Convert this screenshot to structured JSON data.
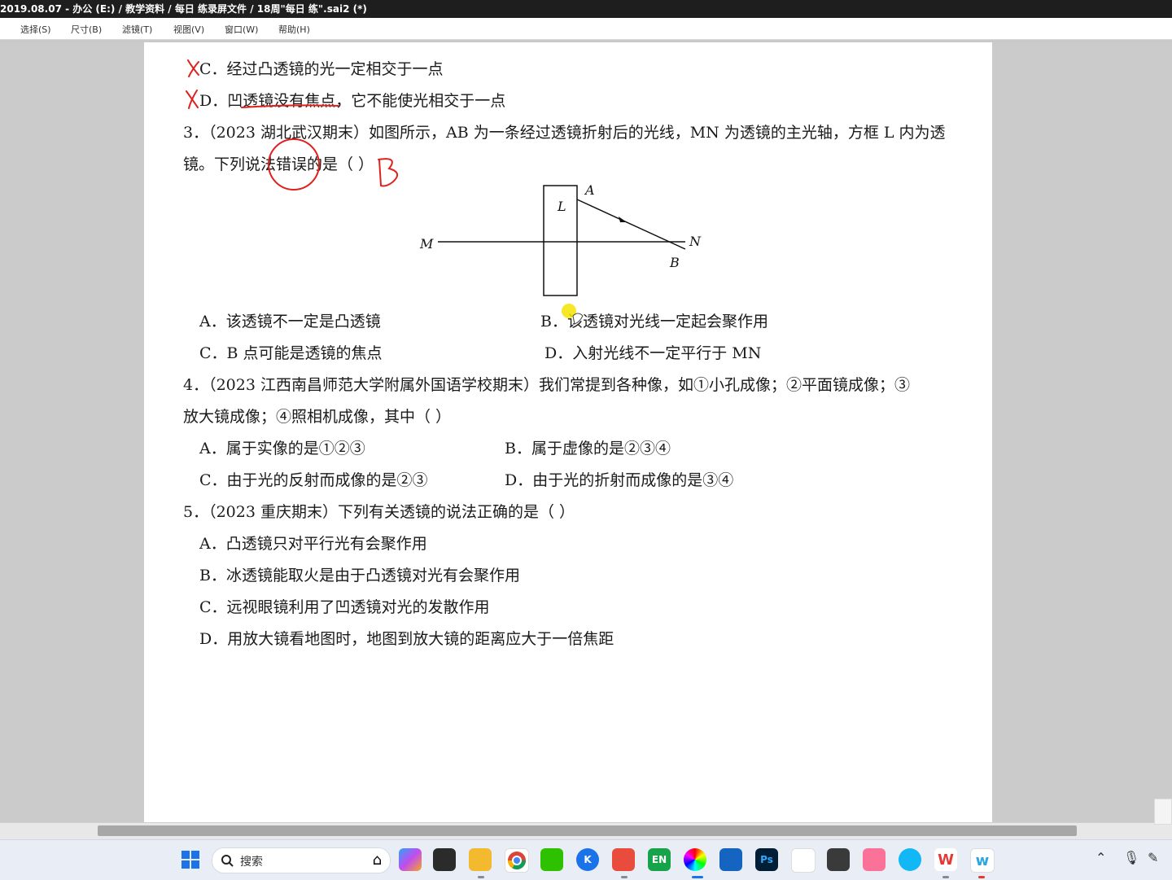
{
  "window": {
    "title": "2019.08.07 - 办公 (E:) / 教学资料 / 每日   练录屏文件 / 18周\"每日   练\".sai2 (*)"
  },
  "menu": [
    "选择(S)",
    "尺寸(B)",
    "滤镜(T)",
    "视图(V)",
    "窗口(W)",
    "帮助(H)"
  ],
  "document": {
    "line_c_prev": "C．经过凸透镜的光一定相交于一点",
    "line_d_prev": "D．凹透镜没有焦点，它不能使光相交于一点",
    "q3_line1": "3．（2023 湖北武汉期末）如图所示，AB 为一条经过透镜折射后的光线，MN 为透镜的主光轴，方框 L 内为透",
    "q3_line2": "镜。下列说法错误的是（      ）",
    "q3_options": {
      "a": "A．该透镜不一定是凸透镜",
      "b": "B．该透镜对光线一定起会聚作用",
      "c": "C．B 点可能是透镜的焦点",
      "d": "D．入射光线不一定平行于 MN"
    },
    "q4_line1": "4．（2023 江西南昌师范大学附属外国语学校期末）我们常提到各种像，如①小孔成像；②平面镜成像；③",
    "q4_line2": "放大镜成像；④照相机成像，其中（      ）",
    "q4_options": {
      "a": "A．属于实像的是①②③",
      "b": "B．属于虚像的是②③④",
      "c": "C．由于光的反射而成像的是②③",
      "d": "D．由于光的折射而成像的是③④"
    },
    "q5_line1": "5．（2023 重庆期末）下列有关透镜的说法正确的是（      ）",
    "q5_options": {
      "a": "A．凸透镜只对平行光有会聚作用",
      "b": "B．冰透镜能取火是由于凸透镜对光有会聚作用",
      "c": "C．远视眼镜利用了凹透镜对光的发散作用",
      "d": "D．用放大镜看地图时，地图到放大镜的距离应大于一倍焦距"
    }
  },
  "diagram": {
    "label_L": "L",
    "label_A": "A",
    "label_B": "B",
    "label_M": "M",
    "label_N": "N"
  },
  "annotations": {
    "answer_mark": "B",
    "ink_color": "#e0201c",
    "highlight_color": "#f5e400"
  },
  "taskbar": {
    "search_label": "搜索",
    "icons": [
      "start-icon",
      "search-icon",
      "copilot-icon",
      "task-view-icon",
      "file-explorer-icon",
      "chrome-icon",
      "wechat-icon",
      "k-app-icon",
      "store-icon",
      "en-app-icon",
      "sai-icon",
      "mingjia-icon",
      "photoshop-icon",
      "baidu-netdisk-icon",
      "cube-app-icon",
      "bilibili-icon",
      "chat-icon",
      "wps-icon",
      "w-app-icon"
    ]
  }
}
